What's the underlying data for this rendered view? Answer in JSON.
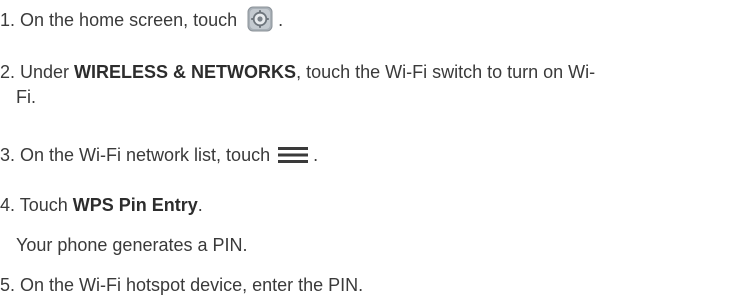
{
  "steps": [
    {
      "number": "1.",
      "text_before": " On the home screen, touch",
      "icon": "settings-gear-icon",
      "text_after": " ."
    },
    {
      "number": "2.",
      "text_before": " Under ",
      "bold": "WIRELESS & NETWORKS",
      "text_after": ", touch the Wi-Fi switch to turn on Wi-",
      "continuation": "Fi."
    },
    {
      "number": "3.",
      "text_before": " On the Wi-Fi network list, touch",
      "icon": "menu-icon",
      "text_after": " ."
    },
    {
      "number": "4.",
      "text_before": " Touch ",
      "bold": "WPS Pin Entry",
      "text_after": ".",
      "note": "Your phone generates a PIN."
    },
    {
      "number": "5.",
      "text_before": " On the Wi-Fi hotspot device, enter the PIN."
    }
  ],
  "colors": {
    "text": "#3a3a3a",
    "icon_bg": "#9aa2aa",
    "menu_icon": "#3a3a3a"
  }
}
